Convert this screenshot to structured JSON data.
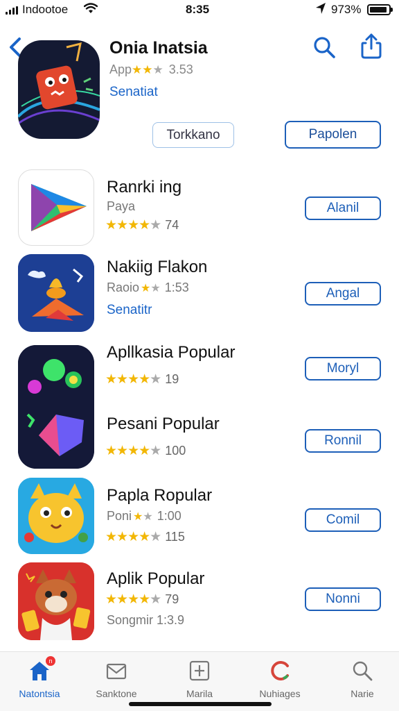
{
  "status_bar": {
    "carrier": "Indootoe",
    "time": "8:35",
    "battery": "973%"
  },
  "header": {
    "title": "Onia Inatsia",
    "subtitle_prefix": "App",
    "rating_value": "3.53",
    "link": "Senatiat",
    "tabs": [
      "Torkkano",
      "Papolen"
    ]
  },
  "apps": [
    {
      "name": "Ranrki ing",
      "subtitle": "Paya",
      "rating": "74",
      "stars": 4,
      "button": "Alanil"
    },
    {
      "name": "Nakiig Flakon",
      "subtitle": "Raoio",
      "subtitle_rating": "1:53",
      "link": "Senatitr",
      "button": "Angal"
    },
    {
      "name": "Apllkasia Popular",
      "rating": "19",
      "stars": 4,
      "button": "Moryl"
    },
    {
      "name": "Pesani Popular",
      "rating": "100",
      "stars": 4,
      "button": "Ronnil"
    },
    {
      "name": "Papla Ropular",
      "subtitle": "Poni",
      "subtitle_rating": "1:00",
      "rating": "115",
      "stars": 4,
      "button": "Comil"
    },
    {
      "name": "Aplik Popular",
      "rating": "79",
      "stars": 4,
      "footer": "Songmir 1:3.9",
      "button": "Nonni"
    }
  ],
  "tab_bar": {
    "items": [
      {
        "label": "Natontsia",
        "icon": "house-icon",
        "active": true,
        "badge": "n"
      },
      {
        "label": "Sanktone",
        "icon": "mail-icon",
        "active": false
      },
      {
        "label": "Marila",
        "icon": "calculator-icon",
        "active": false
      },
      {
        "label": "Nuhiages",
        "icon": "refresh-icon",
        "active": false
      },
      {
        "label": "Narie",
        "icon": "search-icon",
        "active": false
      }
    ]
  },
  "colors": {
    "accent": "#1a64c8",
    "star": "#f2b705",
    "button_border": "#1d5fb8"
  }
}
